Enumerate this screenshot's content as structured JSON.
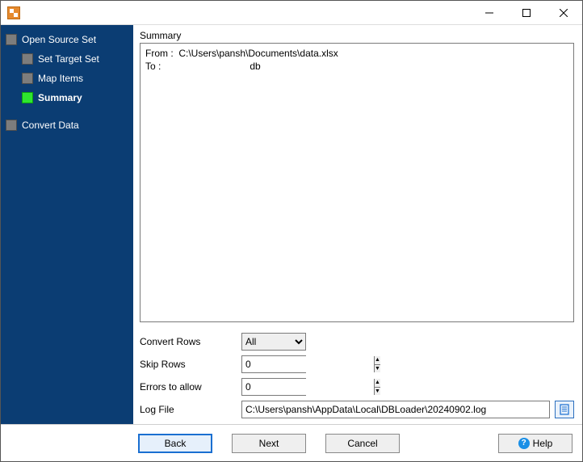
{
  "window": {
    "title": ""
  },
  "sidebar": {
    "items": [
      {
        "label": "Open Source Set",
        "child": false,
        "current": false
      },
      {
        "label": "Set Target Set",
        "child": true,
        "current": false
      },
      {
        "label": "Map Items",
        "child": true,
        "current": false
      },
      {
        "label": "Summary",
        "child": true,
        "current": true
      },
      {
        "label": "Convert Data",
        "child": false,
        "current": false
      }
    ]
  },
  "content": {
    "section_label": "Summary",
    "summary_text": "From :  C:\\Users\\pansh\\Documents\\data.xlsx\nTo :                                 db",
    "form": {
      "convert_rows_label": "Convert Rows",
      "convert_rows_value": "All",
      "skip_rows_label": "Skip Rows",
      "skip_rows_value": "0",
      "errors_label": "Errors to allow",
      "errors_value": "0",
      "logfile_label": "Log File",
      "logfile_value": "C:\\Users\\pansh\\AppData\\Local\\DBLoader\\20240902.log"
    }
  },
  "footer": {
    "back": "Back",
    "next": "Next",
    "cancel": "Cancel",
    "help": "Help"
  }
}
